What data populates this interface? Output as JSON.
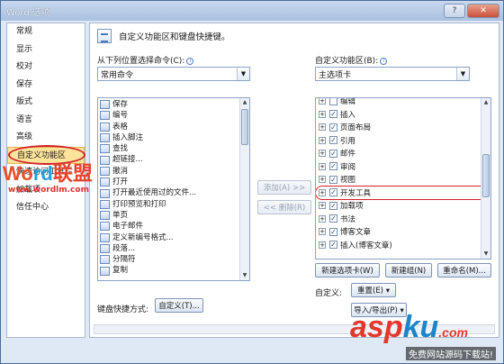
{
  "window": {
    "title": "Word 选项",
    "minimize": "—",
    "maximize": "□",
    "close": "✕"
  },
  "nav": {
    "items": [
      "常规",
      "显示",
      "校对",
      "保存",
      "版式",
      "语言",
      "高级",
      "自定义功能区",
      "快速访问工具栏",
      "加载项",
      "信任中心"
    ],
    "active_index": 7
  },
  "header": {
    "text": "自定义功能区和键盘快捷键。"
  },
  "left": {
    "label": "从下列位置选择命令(C):",
    "info": "i",
    "combo_value": "常用命令",
    "items": [
      {
        "label": "保存",
        "sub": false
      },
      {
        "label": "编号",
        "sub": true
      },
      {
        "label": "表格",
        "sub": true
      },
      {
        "label": "插入脚注",
        "sub": false
      },
      {
        "label": "查找",
        "sub": false
      },
      {
        "label": "超链接...",
        "sub": false
      },
      {
        "label": "撤消",
        "sub": true
      },
      {
        "label": "打开",
        "sub": false
      },
      {
        "label": "打开最近使用过的文件...",
        "sub": false
      },
      {
        "label": "打印预览和打印",
        "sub": false
      },
      {
        "label": "单页",
        "sub": false
      },
      {
        "label": "电子邮件",
        "sub": false
      },
      {
        "label": "定义新编号格式...",
        "sub": false
      },
      {
        "label": "段落...",
        "sub": false
      },
      {
        "label": "分隔符",
        "sub": true
      },
      {
        "label": "复制",
        "sub": false
      }
    ]
  },
  "middle": {
    "add": "添加(A) >>",
    "remove": "<< 删除(R)"
  },
  "right": {
    "label": "自定义功能区(B):",
    "info": "i",
    "combo_value": "主选项卡",
    "items": [
      {
        "label": "编辑",
        "checked": false
      },
      {
        "label": "插入",
        "checked": true
      },
      {
        "label": "页面布局",
        "checked": true
      },
      {
        "label": "引用",
        "checked": true
      },
      {
        "label": "邮件",
        "checked": true
      },
      {
        "label": "审阅",
        "checked": true
      },
      {
        "label": "视图",
        "checked": true
      },
      {
        "label": "开发工具",
        "checked": true
      },
      {
        "label": "加载项",
        "checked": true
      },
      {
        "label": "书法",
        "checked": true
      },
      {
        "label": "博客文章",
        "checked": true
      },
      {
        "label": "插入(博客文章)",
        "checked": true
      }
    ],
    "highlight_index": 7,
    "new_tab": "新建选项卡(W)",
    "new_group": "新建组(N)",
    "rename": "重命名(M)...",
    "customize_label": "自定义:",
    "reset": "重置(E) ▾",
    "import_export": "导入/导出(P) ▾"
  },
  "shortcut": {
    "label": "键盘快捷方式:",
    "button": "自定义(T)..."
  },
  "watermark": {
    "word_w": "Wo",
    "word_r": "rd",
    "word_cn": "联盟",
    "url": "www.wordlm.com",
    "asp_a": "asp",
    "asp_k": "ku",
    "asp_dot": ".com",
    "cn": "免费网站源码下载站!"
  }
}
